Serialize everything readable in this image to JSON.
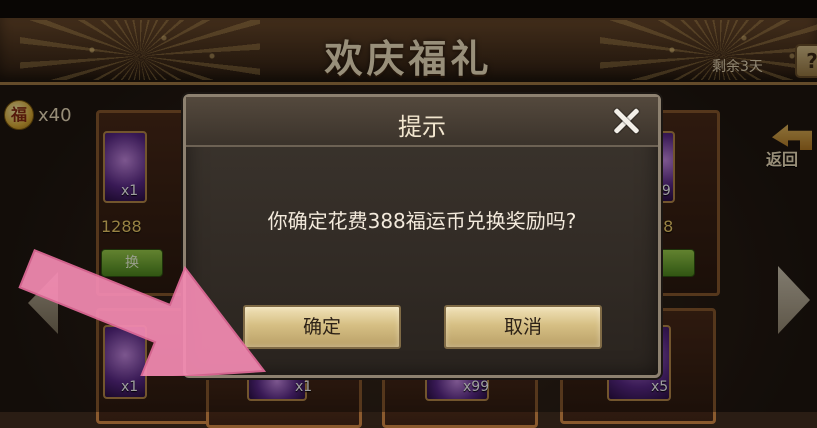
{
  "header": {
    "title": "欢庆福礼",
    "remaining": "剩余3天",
    "help": "?"
  },
  "currency": {
    "symbol": "福",
    "count": "x40"
  },
  "back_button": {
    "label": "返回"
  },
  "cards": [
    {
      "qty": "x1",
      "price": "1288",
      "button": "换"
    },
    {
      "qty": "99",
      "price": "88"
    },
    {
      "qty": "x1"
    },
    {
      "qty": "x1"
    },
    {
      "qty": "x99"
    },
    {
      "qty": "x5"
    }
  ],
  "dialog": {
    "title": "提示",
    "message": "你确定花费388福运币兑换奖励吗?",
    "confirm_label": "确定",
    "cancel_label": "取消"
  },
  "colors": {
    "header_bg": "#4a321d",
    "dialog_bg": "#2a241f",
    "button_gold": "#d6bf84",
    "price_gold": "#f5d26d",
    "annotation_pink": "#f48bb3"
  }
}
